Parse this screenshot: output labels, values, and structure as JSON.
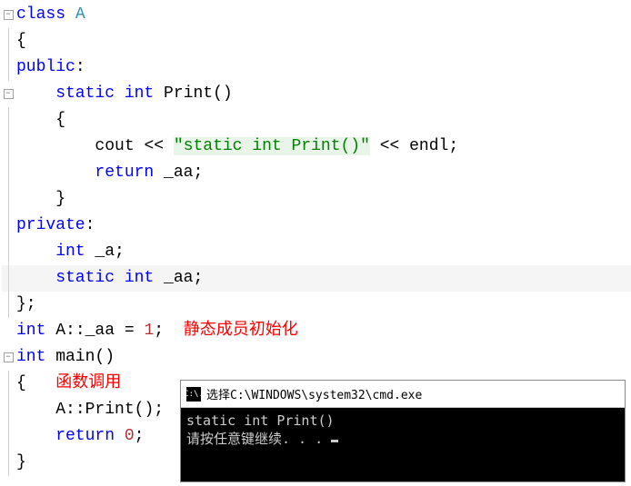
{
  "code": {
    "l1_kw": "class",
    "l1_name": " A",
    "l2_brace": "{",
    "l3_public": "public",
    "l3_colon": ":",
    "l4_kw1": "    static",
    "l4_kw2": " int",
    "l4_fn": " Print",
    "l4_paren": "()",
    "l5_brace": "    {",
    "l6_pre": "        cout ",
    "l6_op1": "<<",
    "l6_sp1": " ",
    "l6_str": "\"static int Print()\"",
    "l6_sp2": " ",
    "l6_op2": "<<",
    "l6_post": " endl;",
    "l7_kw": "        return",
    "l7_rest": " _aa;",
    "l8_brace": "    }",
    "l9_private": "private",
    "l9_colon": ":",
    "l10_kw": "    int",
    "l10_rest": " _a;",
    "l11_kw1": "    static",
    "l11_kw2": " int",
    "l11_rest": " _aa;",
    "l12_brace": "};",
    "l13_kw": "int",
    "l13_rest1": " A",
    "l13_scope": "::",
    "l13_rest2": "_aa ",
    "l13_eq": "=",
    "l13_sp": " ",
    "l13_num": "1",
    "l13_semi": ";",
    "l13_sp2": "  ",
    "l13_comment": "静态成员初始化",
    "l14_kw": "int",
    "l14_fn": " main",
    "l14_paren": "()",
    "l15_brace": "{",
    "l15_sp": "   ",
    "l15_comment": "函数调用",
    "l16_pre": "    A",
    "l16_scope": "::",
    "l16_fn": "Print",
    "l16_rest": "();",
    "l17_kw": "    return",
    "l17_sp": " ",
    "l17_num": "0",
    "l17_semi": ";",
    "l18_brace": "}"
  },
  "console": {
    "icon": "C:\\.",
    "title": "选择C:\\WINDOWS\\system32\\cmd.exe",
    "line1": "static int Print()",
    "line2": "请按任意键继续. . . "
  }
}
